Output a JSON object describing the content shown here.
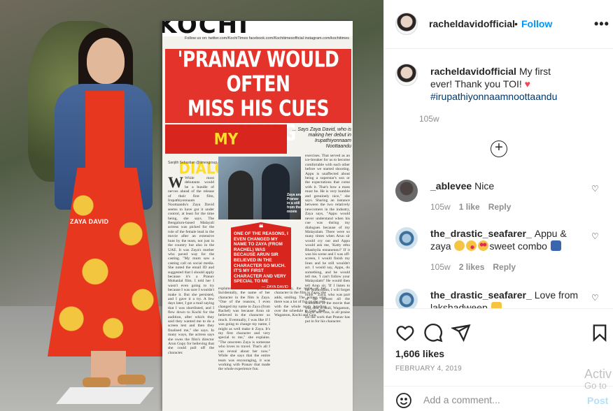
{
  "post": {
    "newspaper": {
      "masthead": "KOCHI",
      "follow_bar": "Follow us on: twitter.com/KochiTimes  facebook.com/Kochitimesofficial  instagram.com/kochitimes",
      "headline_line1": "'PRANAV WOULD OFTEN",
      "headline_line2": "MISS HIS CUES DURING",
      "headline_line3": "MY DIALOGUES'",
      "says": "... Says Zaya David, who is making her debut in Irupathiyonnaam Noottaandu",
      "byline": "Sanjith Sebastian @timesgroup.com",
      "photo_caption": "ZAYA DAVID",
      "inset_caption": "Zaya and Pranav in a still from the movie",
      "quote": "ONE OF THE REASONS, I EVEN CHANGED MY NAME TO ZAYA (FROM RACHEL) WAS BECAUSE ARUN SIR BELIEVED IN THE CHARACTER SO MUCH. IT'S MY FIRST CHARACTER AND VERY SPECIAL TO ME",
      "quote_by": "— ZAYA DAVID",
      "col1": "While most debutants would be a bundle of nerves ahead of the release of their first film, Irupathiyonnaam Noottaandu's Zaya David seems to have got it under control, at least for the time being, she says. The Bengaluru-based Malayali actress was picked for the role of the female lead in the movie after an extensive hunt by the team, not just in the country but also in the UAE. It was Zaya's mother who paved way for the casting. \"My mum saw a casting call on social media. She noted the email ID and suggested that I should apply because it's a Pranav Mohanlal film. I told her I wasn't even going to try because I was sure I wouldn't make it. But she persisted, and I gave it a try. A few days later, I got a mail saying that I was shortlisted, and I flew down to Kochi for the audition, after which they said they wanted me to do a screen test and then they finalised me,\" she says. In many ways, the actress says she owes the film's director Arun Gopy for believing that she could pull off the character.",
      "col2": "explains what was expected.\" Incidentally, the name of her character in the film is Zaya. \"One of the reasons, I even changed my name to Zaya (from Rachel) was because Arun sir believed in the character so much. Eventually, I was like if I was going to change my name, I might as well make it Zaya. It's my first character and very special to me,\" she explains. \"The onscreen Zaya is someone who loves to travel. That's all I can reveal about her now.\" While she says that the entire team was encouraging, it was working with Pranav that made the whole experience fun.",
      "col3": "Incidentally, the name of her character in the film is Zaya, she adds, smiling. The actress says there was a lot of fun on the sets, with the whole team bonding over the schedule in Goa, Bali, Wagamon, Kochi and Goa.",
      "col4": "exercises. That served as an ice-breaker for us to become comfortable with each other before we started shooting. Appu is unaffected about being a superstar's son or the expectations that come with it. That's how a mass must be. He is very humble and genuinely nice,\" she says. Sharing an instance between the two relatively newcomers in the industry, Zaya says, \"Appu would never understand when his cue was during my dialogues because of my Malayalam. There were so many times when Arun sir would cry out and Appu would ask me, 'Katty ethu Bhashyila ennanennu?' If it was his scene and I was off-screen, I would finish my lines and he still wouldn't act. I would say, Appu, do something, and he would tell me, 'I can't follow your Malayalam!' He would then tell Arun sir, 'If I listen to her Malayalam, I will forget mine.'\" Zaya, who was part of the almost all the schedules of the movie that was shot in Bali, Wagamon, Kochi and Goa, is all praise for the work that Pranav has put in for his character."
    }
  },
  "sidebar": {
    "header": {
      "username": "racheldavidofficial",
      "separator": "•",
      "follow_label": "Follow",
      "more_icon": "more-options-icon",
      "more_glyph": "•••"
    },
    "caption": {
      "username": "racheldavidofficial",
      "text": "My first ever! Thank you TOI!",
      "heart": "♥",
      "hashtag": "#irupathiyonnaamnoottaandu",
      "time": "105w"
    },
    "load_more_icon": "plus-circle-icon",
    "load_more_glyph": "+",
    "comments": [
      {
        "username": "_ablevee",
        "text": "Nice",
        "time": "105w",
        "likes": "1 like",
        "reply": "Reply"
      },
      {
        "username": "the_drastic_seafarer_",
        "text_before": "Appu & zaya",
        "text_after": "sweet combo",
        "time": "105w",
        "likes": "2 likes",
        "reply": "Reply"
      },
      {
        "username": "the_drastic_seafarer_",
        "text": "Love from lakshadweep"
      }
    ],
    "like_glyph": "♡",
    "actions": {
      "likes": "1,606 likes",
      "date": "FEBRUARY 4, 2019",
      "comment_placeholder": "Add a comment...",
      "post_label": "Post"
    },
    "watermark": {
      "line1": "Activ",
      "line2": "Go to"
    },
    "colors": {
      "accent": "#0095f6",
      "hashtag": "#00376b",
      "heart": "#ed4956",
      "newspaper_red": "#d8251d",
      "newspaper_yellow": "#ffde2a"
    }
  }
}
